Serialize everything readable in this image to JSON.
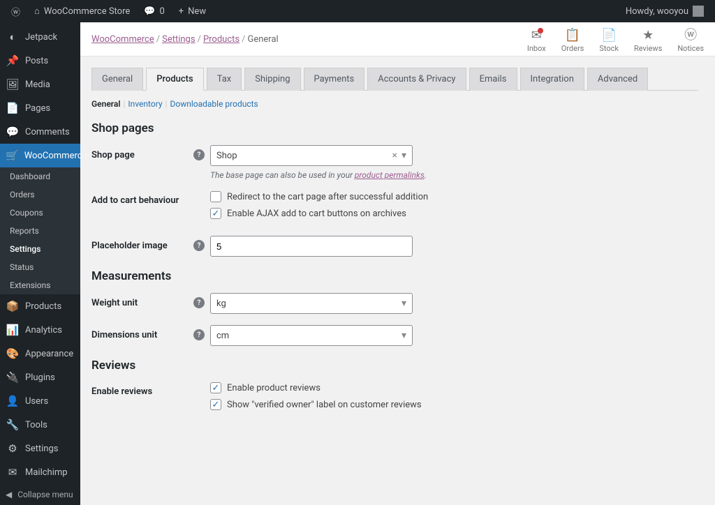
{
  "adminbar": {
    "site_name": "WooCommerce Store",
    "comments_count": "0",
    "new_label": "New",
    "howdy": "Howdy, wooyou"
  },
  "sidebar": {
    "items": [
      {
        "icon": "◐",
        "label": "Jetpack"
      },
      {
        "icon": "📌",
        "label": "Posts"
      },
      {
        "icon": "🖼",
        "label": "Media"
      },
      {
        "icon": "📄",
        "label": "Pages"
      },
      {
        "icon": "💬",
        "label": "Comments"
      },
      {
        "icon": "🛒",
        "label": "WooCommerce",
        "current": true
      },
      {
        "icon": "📦",
        "label": "Products"
      },
      {
        "icon": "📊",
        "label": "Analytics"
      },
      {
        "icon": "🎨",
        "label": "Appearance"
      },
      {
        "icon": "🔌",
        "label": "Plugins"
      },
      {
        "icon": "👤",
        "label": "Users"
      },
      {
        "icon": "🔧",
        "label": "Tools"
      },
      {
        "icon": "⚙",
        "label": "Settings"
      },
      {
        "icon": "✉",
        "label": "Mailchimp"
      }
    ],
    "woo_submenu": [
      "Dashboard",
      "Orders",
      "Coupons",
      "Reports",
      "Settings",
      "Status",
      "Extensions"
    ],
    "woo_submenu_current": "Settings",
    "collapse": "Collapse menu"
  },
  "breadcrumb": [
    "WooCommerce",
    "Settings",
    "Products",
    "General"
  ],
  "top_icons": [
    {
      "icon": "✉",
      "label": "Inbox",
      "badge": true
    },
    {
      "icon": "📋",
      "label": "Orders"
    },
    {
      "icon": "📄",
      "label": "Stock"
    },
    {
      "icon": "★",
      "label": "Reviews"
    },
    {
      "icon": "ⓦ",
      "label": "Notices"
    }
  ],
  "tabs": [
    "General",
    "Products",
    "Tax",
    "Shipping",
    "Payments",
    "Accounts & Privacy",
    "Emails",
    "Integration",
    "Advanced"
  ],
  "tabs_active": "Products",
  "subtabs": [
    "General",
    "Inventory",
    "Downloadable products"
  ],
  "subtabs_active": "General",
  "sections": {
    "shop_pages": "Shop pages",
    "measurements": "Measurements",
    "reviews": "Reviews"
  },
  "fields": {
    "shop_page": {
      "label": "Shop page",
      "value": "Shop",
      "desc_pre": "The base page can also be used in your ",
      "desc_link": "product permalinks",
      "desc_post": "."
    },
    "cart_behaviour": {
      "label": "Add to cart behaviour",
      "opt1": "Redirect to the cart page after successful addition",
      "opt2": "Enable AJAX add to cart buttons on archives"
    },
    "placeholder": {
      "label": "Placeholder image",
      "value": "5"
    },
    "weight_unit": {
      "label": "Weight unit",
      "value": "kg"
    },
    "dimensions_unit": {
      "label": "Dimensions unit",
      "value": "cm"
    },
    "enable_reviews": {
      "label": "Enable reviews",
      "opt1": "Enable product reviews",
      "opt2": "Show \"verified owner\" label on customer reviews"
    }
  }
}
